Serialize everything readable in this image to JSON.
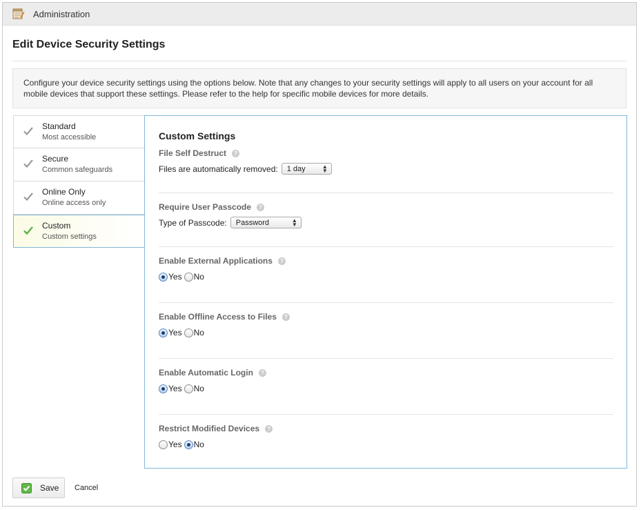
{
  "header": {
    "title": "Administration",
    "icon": "notepad-icon"
  },
  "page": {
    "title": "Edit Device Security Settings",
    "intro": "Configure your device security settings using the options below. Note that any changes to your security settings will apply to all users on your account for all mobile devices that support these settings. Please refer to the help for specific mobile devices for more details."
  },
  "sidebar": {
    "items": [
      {
        "name": "Standard",
        "sub": "Most accessible"
      },
      {
        "name": "Secure",
        "sub": "Common safeguards"
      },
      {
        "name": "Online Only",
        "sub": "Online access only"
      },
      {
        "name": "Custom",
        "sub": "Custom settings"
      }
    ],
    "active_index": 3
  },
  "panel": {
    "title": "Custom Settings",
    "help_glyph": "?",
    "file_self_destruct": {
      "label": "File Self Destruct",
      "field_label": "Files are automatically removed:",
      "value": "1 day"
    },
    "require_passcode": {
      "label": "Require User Passcode",
      "field_label": "Type of Passcode:",
      "value": "Password"
    },
    "external_apps": {
      "label": "Enable External Applications",
      "selected": "Yes"
    },
    "offline_access": {
      "label": "Enable Offline Access to Files",
      "selected": "Yes"
    },
    "auto_login": {
      "label": "Enable Automatic Login",
      "selected": "Yes"
    },
    "restrict_modified": {
      "label": "Restrict Modified Devices",
      "selected": "No"
    },
    "yes_label": "Yes",
    "no_label": "No"
  },
  "footer": {
    "save_label": "Save",
    "cancel_label": "Cancel"
  },
  "colors": {
    "accent_border": "#7fb6d9",
    "check_green": "#5cb544",
    "check_gray": "#9a9a9a"
  }
}
